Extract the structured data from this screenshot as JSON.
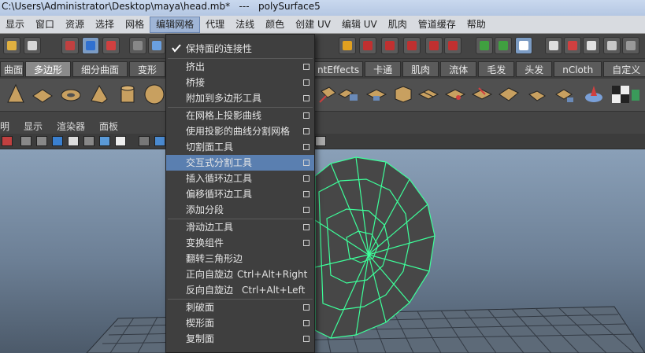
{
  "window": {
    "title": "C:\\Users\\Administrator\\Desktop\\maya\\head.mb*   ---   polySurface5"
  },
  "menubar": {
    "items": [
      "显示",
      "窗口",
      "资源",
      "选择",
      "网格",
      "编辑网格",
      "代理",
      "法线",
      "颜色",
      "创建 UV",
      "编辑 UV",
      "肌肉",
      "管道缓存",
      "帮助"
    ],
    "active": "编辑网格"
  },
  "shelf_tabs": {
    "items": [
      "曲面",
      "多边形",
      "细分曲面",
      "变形",
      "ntEffects",
      "卡通",
      "肌肉",
      "流体",
      "毛发",
      "头发",
      "nCloth",
      "自定义"
    ],
    "selected": "多边形"
  },
  "panel_menu": {
    "items": [
      "明",
      "显示",
      "渲染器",
      "面板"
    ]
  },
  "dropdown": {
    "items": [
      {
        "label": "保持面的连接性",
        "checked": true,
        "option": false,
        "shortcut": ""
      },
      {
        "label": "挤出",
        "checked": false,
        "option": true,
        "shortcut": ""
      },
      {
        "label": "桥接",
        "checked": false,
        "option": true,
        "shortcut": ""
      },
      {
        "label": "附加到多边形工具",
        "checked": false,
        "option": true,
        "shortcut": ""
      },
      {
        "label": "在网格上投影曲线",
        "checked": false,
        "option": true,
        "shortcut": ""
      },
      {
        "label": "使用投影的曲线分割网格",
        "checked": false,
        "option": true,
        "shortcut": ""
      },
      {
        "label": "切割面工具",
        "checked": false,
        "option": true,
        "shortcut": ""
      },
      {
        "label": "交互式分割工具",
        "checked": false,
        "option": true,
        "shortcut": "",
        "highlighted": true
      },
      {
        "label": "插入循环边工具",
        "checked": false,
        "option": true,
        "shortcut": ""
      },
      {
        "label": "偏移循环边工具",
        "checked": false,
        "option": true,
        "shortcut": ""
      },
      {
        "label": "添加分段",
        "checked": false,
        "option": true,
        "shortcut": ""
      },
      {
        "label": "滑动边工具",
        "checked": false,
        "option": true,
        "shortcut": ""
      },
      {
        "label": "变换组件",
        "checked": false,
        "option": true,
        "shortcut": ""
      },
      {
        "label": "翻转三角形边",
        "checked": false,
        "option": false,
        "shortcut": ""
      },
      {
        "label": "正向自旋边",
        "checked": false,
        "option": false,
        "shortcut": "Ctrl+Alt+Right"
      },
      {
        "label": "反向自旋边",
        "checked": false,
        "option": false,
        "shortcut": "Ctrl+Alt+Left"
      },
      {
        "label": "刺破面",
        "checked": false,
        "option": true,
        "shortcut": ""
      },
      {
        "label": "楔形面",
        "checked": false,
        "option": true,
        "shortcut": ""
      },
      {
        "label": "复制面",
        "checked": false,
        "option": true,
        "shortcut": ""
      }
    ]
  },
  "colors": {
    "menu_highlight": "#5a7fb0",
    "wireframe": "#3dff9a",
    "viewport_top": "#8aa0b8"
  }
}
